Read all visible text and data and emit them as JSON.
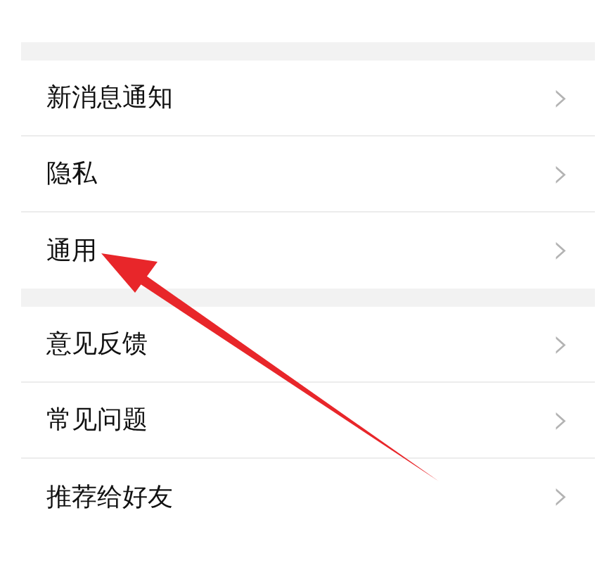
{
  "groups": [
    {
      "items": [
        {
          "label": "新消息通知",
          "chevron": "›"
        },
        {
          "label": "隐私",
          "chevron": "›"
        },
        {
          "label": "通用",
          "chevron": "›"
        }
      ]
    },
    {
      "items": [
        {
          "label": "意见反馈",
          "chevron": "›"
        },
        {
          "label": "常见问题",
          "chevron": "›"
        },
        {
          "label": "推荐给好友",
          "chevron": "›"
        }
      ]
    }
  ]
}
